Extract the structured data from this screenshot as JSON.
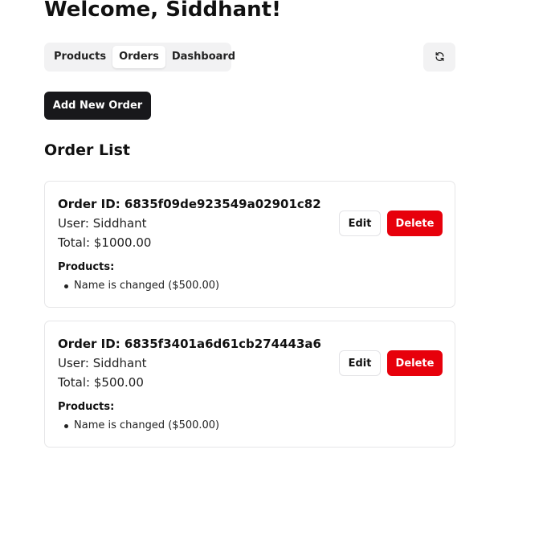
{
  "header": {
    "title": "Welcome, Siddhant!"
  },
  "tabs": [
    {
      "label": "Products",
      "active": false
    },
    {
      "label": "Orders",
      "active": true
    },
    {
      "label": "Dashboard",
      "active": false
    }
  ],
  "toolbar": {
    "refresh_icon": "refresh-icon",
    "add_label": "Add New Order"
  },
  "orders_section": {
    "title": "Order List"
  },
  "orders": [
    {
      "order_id": "Order ID: 6835f09de923549a02901c82",
      "user": "User: Siddhant",
      "total": "Total: $1000.00",
      "products_label": "Products:",
      "products": [
        "Name is changed ($500.00)"
      ],
      "edit_label": "Edit",
      "delete_label": "Delete"
    },
    {
      "order_id": "Order ID: 6835f3401a6d61cb274443a6",
      "user": "User: Siddhant",
      "total": "Total: $500.00",
      "products_label": "Products:",
      "products": [
        "Name is changed ($500.00)"
      ],
      "edit_label": "Edit",
      "delete_label": "Delete"
    }
  ],
  "colors": {
    "primary_button": "#18181b",
    "danger": "#e7000b",
    "tab_bg": "#f2f2f3",
    "card_border": "#e6e6e8"
  }
}
